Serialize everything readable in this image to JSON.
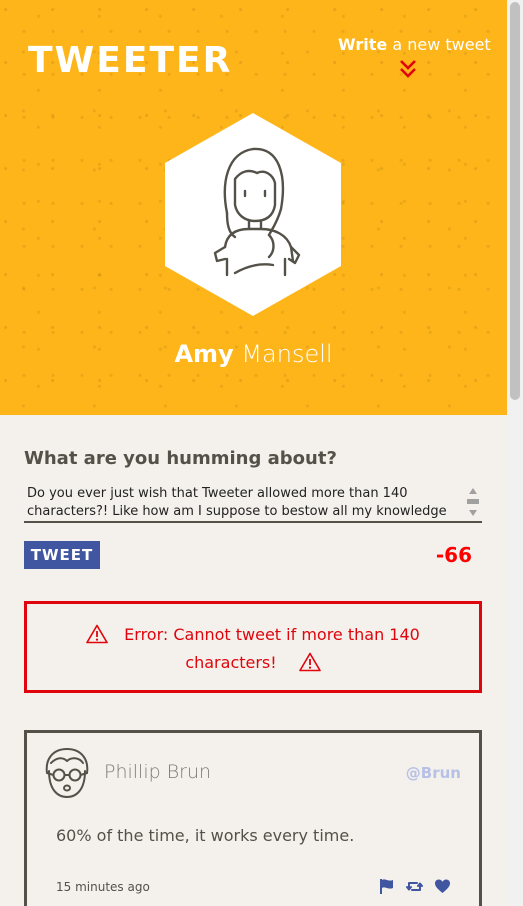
{
  "app": {
    "logo": "TWEETER",
    "write_link": {
      "bold": "Write",
      "rest": " a new tweet"
    }
  },
  "profile": {
    "first_name": "Amy",
    "last_name": " Mansell"
  },
  "compose": {
    "title": "What are you humming about?",
    "text": "Do you ever just wish that Tweeter allowed more than 140 characters?! Like how am I suppose to bestow all my knowledge to",
    "button_label": "TWEET",
    "counter": "-66"
  },
  "error": {
    "line1": "Error: Cannot tweet if more than 140",
    "line2": "characters!"
  },
  "tweets": [
    {
      "author": "Phillip Brun",
      "handle": "@Brun",
      "content": "60% of the time, it works every time.",
      "time": "15 minutes ago",
      "actions": [
        "flag-icon",
        "retweet-icon",
        "heart-icon"
      ]
    }
  ],
  "colors": {
    "header_bg": "#fdb51a",
    "accent_blue": "#4056a1",
    "error_red": "#e0050c",
    "text_dark": "#545149",
    "page_bg": "#f4f1ec"
  }
}
